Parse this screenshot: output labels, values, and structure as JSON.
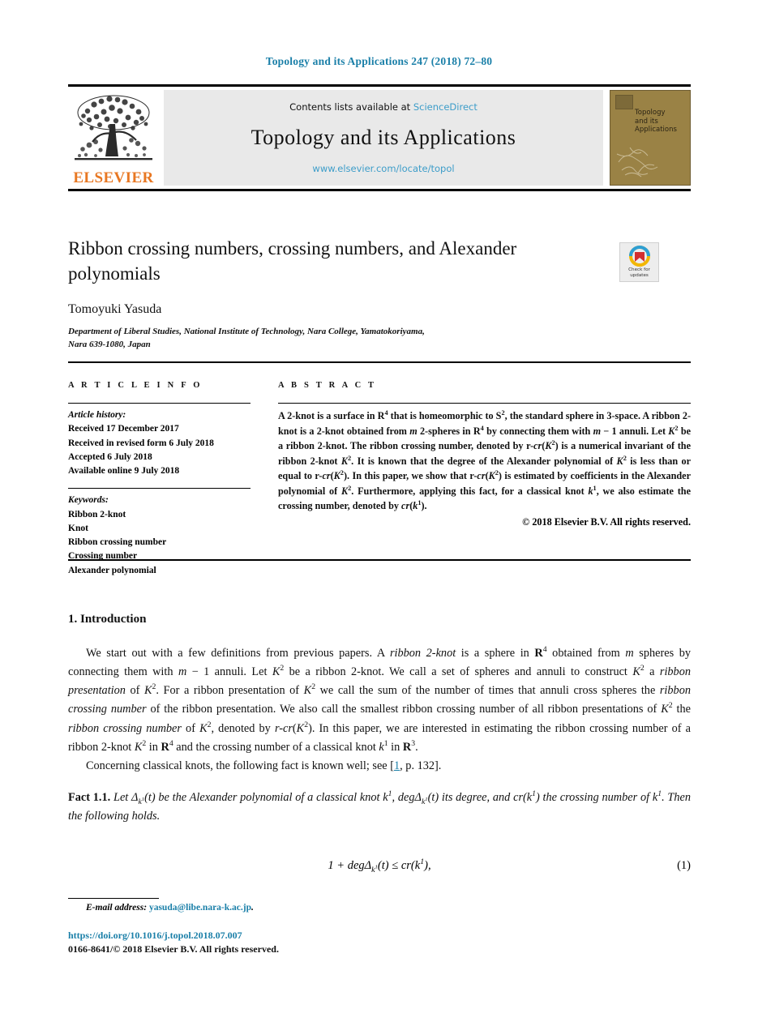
{
  "running_head": "Topology and its Applications 247 (2018) 72–80",
  "masthead": {
    "publisher_name": "ELSEVIER",
    "publisher_logo_icon": "elsevier-tree-icon",
    "contents_prefix": "Contents lists available at ",
    "contents_link": "ScienceDirect",
    "journal_title": "Topology and its Applications",
    "journal_url": "www.elsevier.com/locate/topol",
    "cover": {
      "line1": "Topology",
      "line2": "and its",
      "line3": "Applications",
      "bg_color": "#9a8245"
    }
  },
  "article": {
    "title": "Ribbon crossing numbers, crossing numbers, and Alexander polynomials",
    "author": "Tomoyuki Yasuda",
    "affiliation_line1": "Department of Liberal Studies, National Institute of Technology, Nara College, Yamatokoriyama,",
    "affiliation_line2": "Nara 639-1080, Japan",
    "crossmark": {
      "label_line1": "Check for",
      "label_line2": "updates"
    }
  },
  "info": {
    "heading": "A R T I C L E   I N F O",
    "history_label": "Article history:",
    "history": [
      "Received 17 December 2017",
      "Received in revised form 6 July 2018",
      "Accepted 6 July 2018",
      "Available online 9 July 2018"
    ],
    "keywords_label": "Keywords:",
    "keywords": [
      "Ribbon 2-knot",
      "Knot",
      "Ribbon crossing number",
      "Crossing number",
      "Alexander polynomial"
    ]
  },
  "abstract": {
    "heading": "A B S T R A C T",
    "copyright": "© 2018 Elsevier B.V. All rights reserved."
  },
  "body": {
    "section_number_title": "1. Introduction",
    "equation_number": "(1)"
  },
  "footer": {
    "email_label": "E-mail address:",
    "email": "yasuda@libe.nara-k.ac.jp",
    "email_period": ".",
    "doi": "https://doi.org/10.1016/j.topol.2018.07.007",
    "issn_line": "0166-8641/© 2018 Elsevier B.V. All rights reserved."
  },
  "colors": {
    "link_blue": "#1a7fa8",
    "sciencedirect_blue": "#3d9dc9",
    "elsevier_orange": "#E87722",
    "cover_tan": "#9a8245"
  }
}
